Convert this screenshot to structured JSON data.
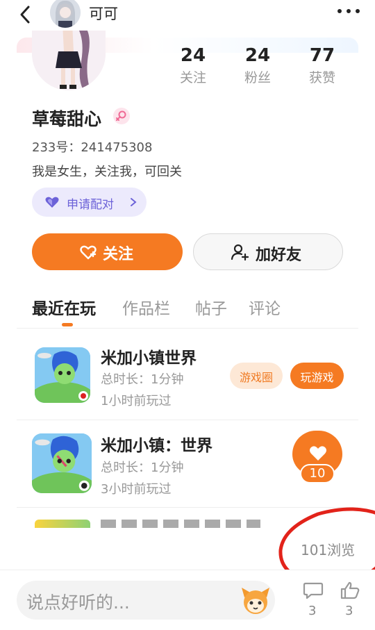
{
  "header": {
    "name": "可可",
    "back_icon": "chevron-left-icon",
    "more_icon": "more-dots-icon"
  },
  "profile": {
    "stats": [
      {
        "value": "24",
        "label": "关注"
      },
      {
        "value": "24",
        "label": "粉丝"
      },
      {
        "value": "77",
        "label": "获赞"
      }
    ],
    "nickname": "草莓甜心",
    "gender_icon": "female-icon",
    "id_text": "233号：241475308",
    "bio": "我是女生，关注我，可回关",
    "pair_button": "申请配对",
    "follow_button": "关注",
    "add_friend_button": "加好友"
  },
  "tabs": [
    {
      "label": "最近在玩",
      "active": true
    },
    {
      "label": "作品栏",
      "active": false
    },
    {
      "label": "帖子",
      "active": false
    },
    {
      "label": "评论",
      "active": false
    }
  ],
  "games": [
    {
      "title": "米加小镇世界",
      "duration": "总时长：1分钟",
      "last_played": "1小时前玩过",
      "circle_button": "游戏圈",
      "play_button": "玩游戏"
    },
    {
      "title": "米加小镇：世界",
      "duration": "总时长：1分钟",
      "last_played": "3小时前玩过"
    }
  ],
  "like_fab": {
    "count": "10",
    "icon": "heart-icon"
  },
  "views_text": "101浏览",
  "bottom_bar": {
    "comment_placeholder": "说点好听的...",
    "comment_count": "3",
    "like_count": "3"
  },
  "colors": {
    "accent": "#f57a22",
    "pair_purple": "#6c62d8",
    "annotation_red": "#e2231a"
  }
}
